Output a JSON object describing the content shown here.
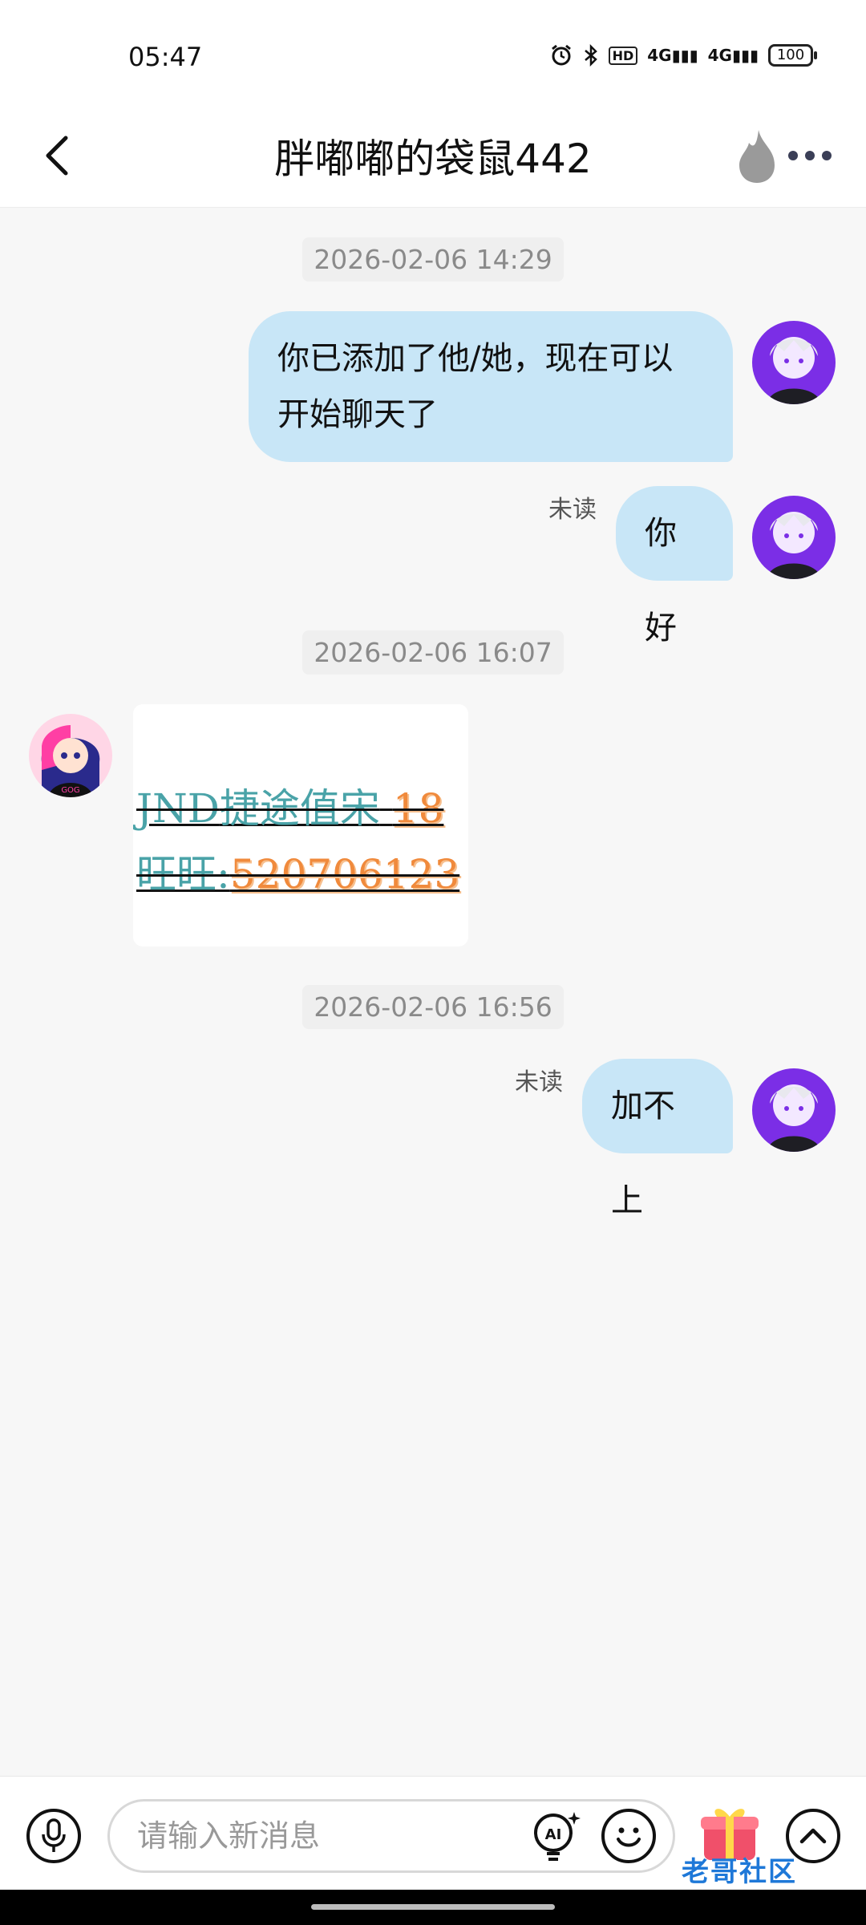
{
  "status_bar": {
    "time": "05:47",
    "hd_label": "HD",
    "signal_1": "4G",
    "signal_2": "4G",
    "battery": "100"
  },
  "header": {
    "title": "胖嘟嘟的袋鼠442"
  },
  "messages": [
    {
      "type": "timestamp",
      "text": "2026-02-06 14:29"
    },
    {
      "type": "text",
      "side": "right",
      "text_line1": "你已添加了他/她，现在可以",
      "text_line2": "开始聊天了"
    },
    {
      "type": "text",
      "side": "right",
      "text": "你好",
      "status": "未读"
    },
    {
      "type": "timestamp",
      "text": "2026-02-06 16:07"
    },
    {
      "type": "image",
      "side": "left",
      "line1_a": "JND",
      "line1_b": "捷途值宋",
      "line1_c": "18",
      "line2_a": "旺旺:",
      "line2_b": "520706123"
    },
    {
      "type": "timestamp",
      "text": "2026-02-06 16:56"
    },
    {
      "type": "text",
      "side": "right",
      "text": "加不上",
      "status": "未读"
    }
  ],
  "input_bar": {
    "placeholder": "请输入新消息",
    "ai_label": "AI"
  },
  "watermark": "老哥社区",
  "colors": {
    "bubble": "#c8e6f7",
    "background": "#f7f7f7",
    "timestamp_text": "#8a8a8a"
  }
}
